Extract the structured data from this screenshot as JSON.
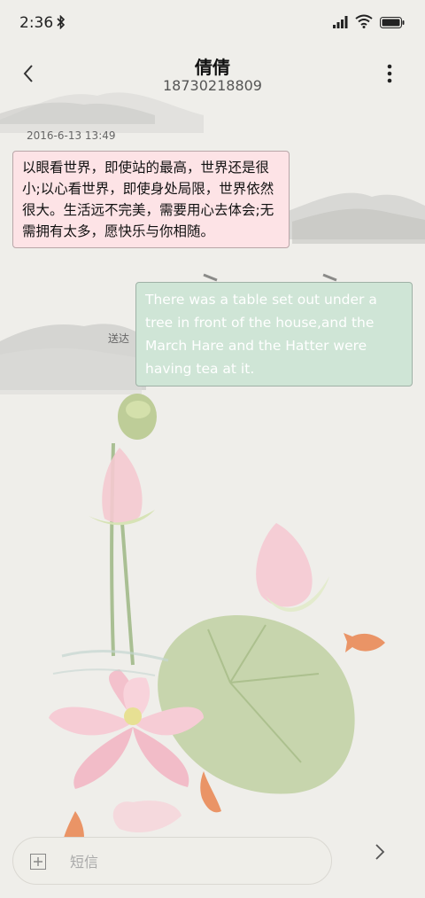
{
  "status_bar": {
    "time": "2:36",
    "icons": [
      "bluetooth-icon",
      "signal-icon",
      "wifi-icon",
      "battery-icon"
    ]
  },
  "header": {
    "contact_name": "倩倩",
    "contact_number": "18730218809",
    "icons": [
      "back-arrow-icon",
      "more-vertical-icon"
    ]
  },
  "conversation": {
    "timestamp": "2016-6-13 13:49",
    "messages": [
      {
        "direction": "incoming",
        "text": "以眼看世界，即使站的最高，世界还是很小;以心看世界，即使身处局限，世界依然很大。生活远不完美，需要用心去体会;无需拥有太多，愿快乐与你相随。"
      },
      {
        "direction": "outgoing",
        "text": "There was a table set out under a tree in front of the house,and the March Hare and the Hatter were having tea at it.",
        "status": "送达"
      }
    ]
  },
  "composer": {
    "placeholder": "短信",
    "value": "",
    "icons": [
      "attach-plus-icon",
      "send-arrow-icon"
    ]
  },
  "colors": {
    "background": "#efeeea",
    "incoming_bubble": "#fde3e6",
    "outgoing_bubble": "#cfe5d6",
    "outgoing_text": "#ffffff"
  }
}
